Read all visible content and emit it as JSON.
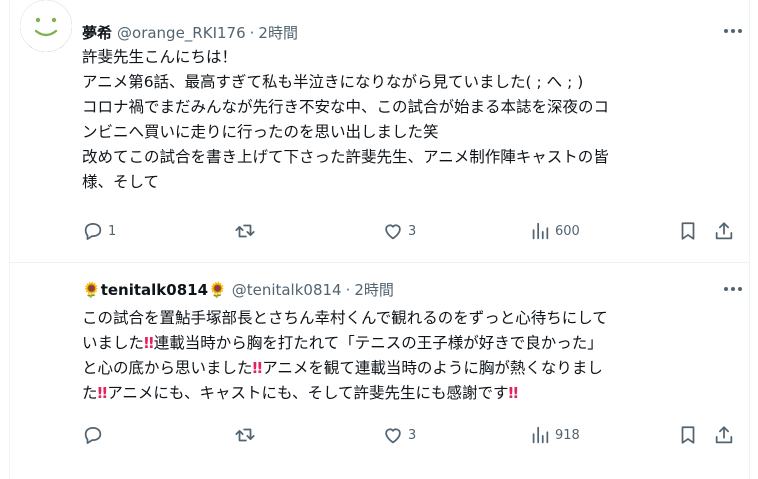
{
  "tweets": [
    {
      "display_name": "夢希",
      "handle": "@orange_RKI176",
      "separator": "·",
      "time": "2時間",
      "lines": [
        "許斐先生こんにちは！",
        "アニメ第6話、最高すぎて私も半泣きになりながら見ていました( ; へ ; )",
        "コロナ禍でまだみんなが先行き不安な中、この試合が始まる本誌を深夜のコ",
        "ンビニへ買いに走りに行ったのを思い出しました笑",
        "改めてこの試合を書き上げて下さった許斐先生、アニメ制作陣キャストの皆",
        "様、そして"
      ],
      "replies": "1",
      "retweets": "",
      "likes": "3",
      "views": "600"
    },
    {
      "display_name_emoji": "🌻",
      "display_name": "tenitalk0814",
      "handle": "@tenitalk0814",
      "separator": "·",
      "time": "2時間",
      "lines": [
        [
          "この試合を置鮎手塚部長とさちん幸村くんで観れるのをずっと心待ちにして"
        ],
        [
          "いました",
          "‼",
          "連載当時から胸を打たれて「テニスの王子様が好きで良かった」"
        ],
        [
          "と心の底から思いました",
          "‼",
          "アニメを観て連載当時のように胸が熱くなりまし"
        ],
        [
          "た",
          "‼",
          "アニメにも、キャストにも、そして許斐先生にも感謝です",
          "‼"
        ]
      ],
      "replies": "",
      "retweets": "",
      "likes": "3",
      "views": "918"
    }
  ],
  "icons": {
    "reply": "reply-icon",
    "retweet": "retweet-icon",
    "like": "heart-icon",
    "views": "views-icon",
    "bookmark": "bookmark-icon",
    "share": "share-icon",
    "more": "more-options-icon"
  },
  "colors": {
    "text": "#0f1419",
    "secondary": "#536471",
    "divider": "#eff3f4",
    "emphasis": "#e0245e"
  }
}
